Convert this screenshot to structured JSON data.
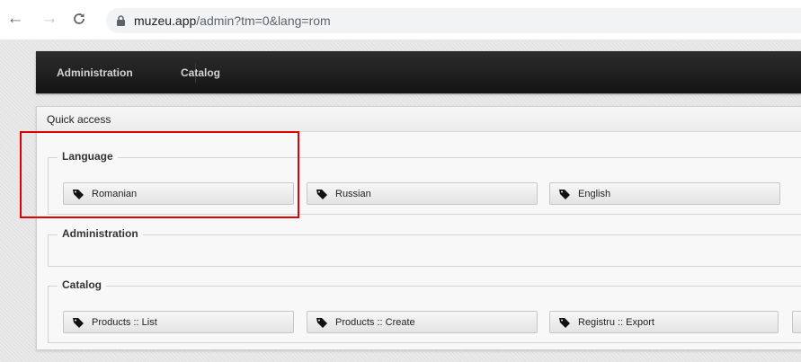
{
  "browser": {
    "url_host": "muzeu.app",
    "url_path": "/admin?tm=0&lang=rom",
    "back_icon": "arrow-left-icon",
    "forward_icon": "arrow-right-icon",
    "reload_icon": "reload-icon",
    "lock_icon": "lock-icon"
  },
  "navbar": {
    "items": [
      {
        "label": "Administration"
      },
      {
        "label": "Catalog"
      }
    ]
  },
  "panel": {
    "title": "Quick access",
    "groups": [
      {
        "legend": "Language",
        "buttons": [
          {
            "label": "Romanian",
            "icon": "tag-icon"
          },
          {
            "label": "Russian",
            "icon": "tag-icon"
          },
          {
            "label": "English",
            "icon": "tag-icon"
          }
        ]
      },
      {
        "legend": "Administration",
        "buttons": []
      },
      {
        "legend": "Catalog",
        "buttons": [
          {
            "label": "Products :: List",
            "icon": "tag-icon"
          },
          {
            "label": "Products :: Create",
            "icon": "tag-icon"
          },
          {
            "label": "Registru :: Export",
            "icon": "tag-icon"
          }
        ]
      }
    ]
  },
  "colors": {
    "highlight": "#e00000",
    "navbar": "#1c1c1c"
  }
}
